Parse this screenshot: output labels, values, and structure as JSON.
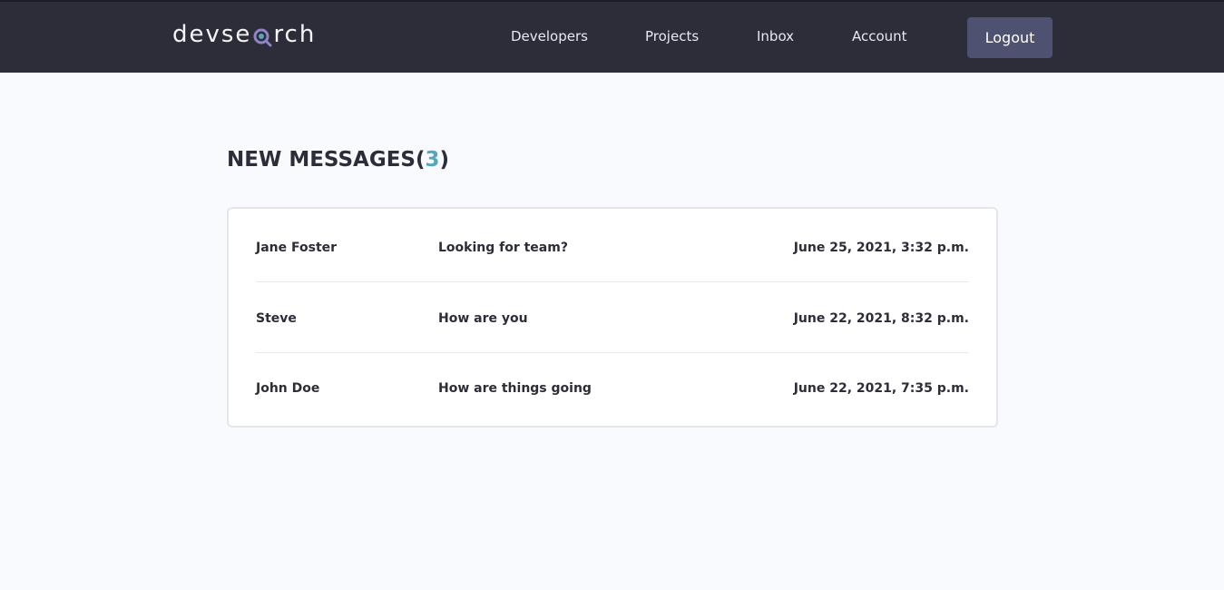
{
  "brand": {
    "logo_text_before": "devse",
    "logo_text_after": "rch",
    "logo_icon": "magnifier-icon"
  },
  "nav": {
    "items": [
      {
        "label": "Developers"
      },
      {
        "label": "Projects"
      },
      {
        "label": "Inbox"
      },
      {
        "label": "Account"
      }
    ],
    "logout_label": "Logout"
  },
  "inbox": {
    "heading": "NEW MESSAGES(",
    "count": "3",
    "heading_close": ")",
    "messages": [
      {
        "sender": "Jane Foster",
        "subject": "Looking for team?",
        "date": "June 25, 2021, 3:32 p.m."
      },
      {
        "sender": "Steve",
        "subject": "How are you",
        "date": "June 22, 2021, 8:32 p.m."
      },
      {
        "sender": "John Doe",
        "subject": "How are things going",
        "date": "June 22, 2021, 7:35 p.m."
      }
    ]
  },
  "colors": {
    "header_bg": "#2d2d39",
    "accent": "#5aa5b9",
    "logout_bg": "#4e5170",
    "page_bg": "#f8fafd"
  }
}
